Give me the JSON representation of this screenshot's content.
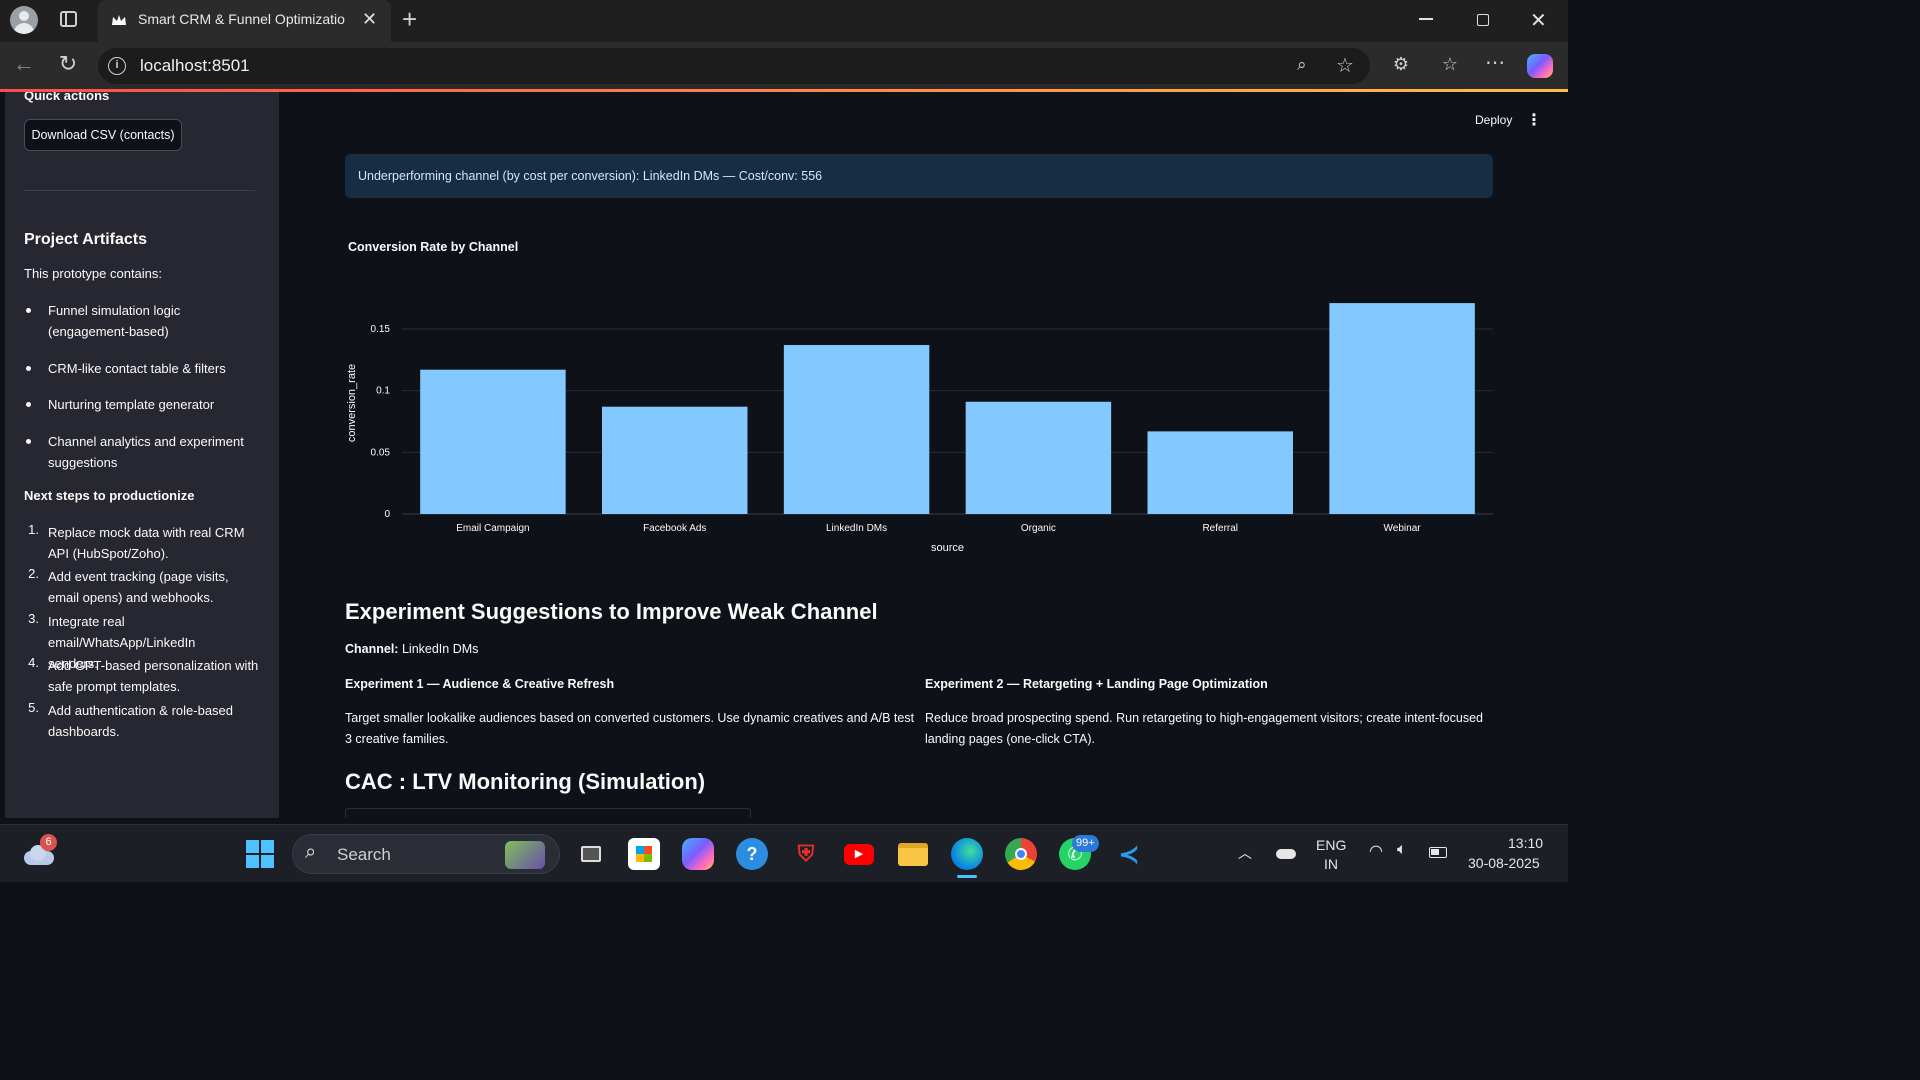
{
  "browser": {
    "tab_title": "Smart CRM & Funnel Optimizatio",
    "url": "localhost:8501"
  },
  "app": {
    "deploy_label": "Deploy",
    "info_banner": "Underperforming channel (by cost per conversion): LinkedIn DMs — Cost/conv: 556"
  },
  "sidebar": {
    "quick_actions_label": "Quick actions",
    "download_button": "Download CSV (contacts)",
    "artifacts_title": "Project Artifacts",
    "artifacts_intro": "This prototype contains:",
    "artifacts_items": [
      "Funnel simulation logic (engagement-based)",
      "CRM-like contact table & filters",
      "Nurturing template generator",
      "Channel analytics and experiment suggestions"
    ],
    "next_steps_title": "Next steps to productionize",
    "next_steps_items": [
      "Replace mock data with real CRM API (HubSpot/Zoho).",
      "Add event tracking (page visits, email opens) and webhooks.",
      "Integrate real email/WhatsApp/LinkedIn senders.",
      "Add GPT-based personalization with safe prompt templates.",
      "Add authentication & role-based dashboards."
    ]
  },
  "chart_data": {
    "type": "bar",
    "title": "Conversion Rate by Channel",
    "xlabel": "source",
    "ylabel": "conversion_rate",
    "categories": [
      "Email Campaign",
      "Facebook Ads",
      "LinkedIn DMs",
      "Organic",
      "Referral",
      "Webinar"
    ],
    "values": [
      0.117,
      0.087,
      0.137,
      0.091,
      0.067,
      0.171
    ],
    "ylim": [
      0,
      0.18
    ],
    "yticks": [
      0,
      0.05,
      0.1,
      0.15
    ],
    "ytick_labels": [
      "0",
      "0.05",
      "0.1",
      "0.15"
    ],
    "bar_color": "#83c9ff",
    "grid": true,
    "legend": "none"
  },
  "experiments": {
    "heading": "Experiment Suggestions to Improve Weak Channel",
    "channel_label": "Channel:",
    "channel_value": "LinkedIn DMs",
    "exp1_title": "Experiment 1 — Audience & Creative Refresh",
    "exp1_body": "Target smaller lookalike audiences based on converted customers. Use dynamic creatives and A/B test 3 creative families.",
    "exp2_title": "Experiment 2 — Retargeting + Landing Page Optimization",
    "exp2_body": "Reduce broad prospecting spend. Run retargeting to high-engagement visitors; create intent-focused landing pages (one-click CTA)."
  },
  "cac_ltv": {
    "heading": "CAC : LTV Monitoring (Simulation)"
  },
  "taskbar": {
    "weather_badge": "6",
    "search_label": "Search",
    "whatsapp_badge": "99+",
    "lang_line1": "ENG",
    "lang_line2": "IN",
    "time": "13:10",
    "date": "30-08-2025"
  },
  "colors": {
    "accent_start": "#ff4b4b",
    "accent_end": "#ffbd45",
    "bar": "#83c9ff",
    "info_bg": "#172d43",
    "info_text": "#c7ebff"
  }
}
